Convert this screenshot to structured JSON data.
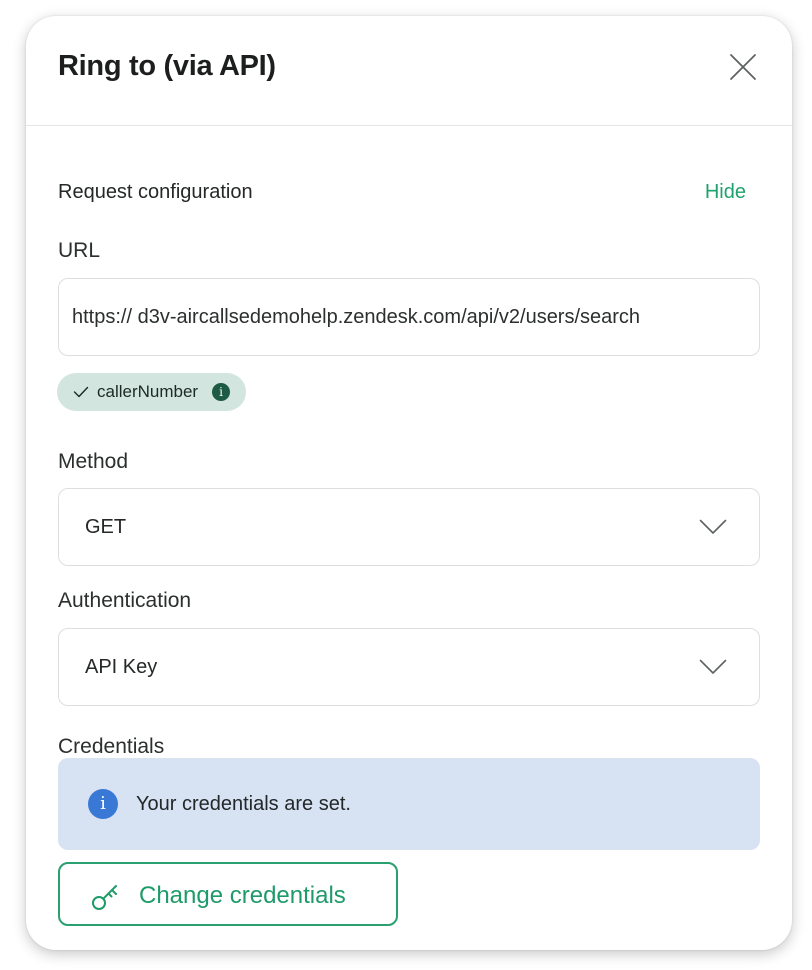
{
  "dialog": {
    "title": "Ring to (via API)"
  },
  "section": {
    "title": "Request configuration",
    "toggle_label": "Hide"
  },
  "url": {
    "label": "URL",
    "value": "https:// d3v-aircallsedemohelp.zendesk.com/api/v2/users/search"
  },
  "variable_chip": {
    "label": "callerNumber"
  },
  "method": {
    "label": "Method",
    "selected": "GET"
  },
  "authentication": {
    "label": "Authentication",
    "selected": "API Key"
  },
  "credentials": {
    "label": "Credentials",
    "info_text": "Your credentials are set.",
    "button_label": "Change credentials"
  },
  "colors": {
    "accent": "#1fa36e",
    "chip_bg": "#d3e5df",
    "info_bg": "#d7e2f3",
    "info_icon": "#3a78d6"
  },
  "icons": [
    "close-icon",
    "check-icon",
    "info-icon",
    "chevron-down-icon",
    "key-icon"
  ]
}
